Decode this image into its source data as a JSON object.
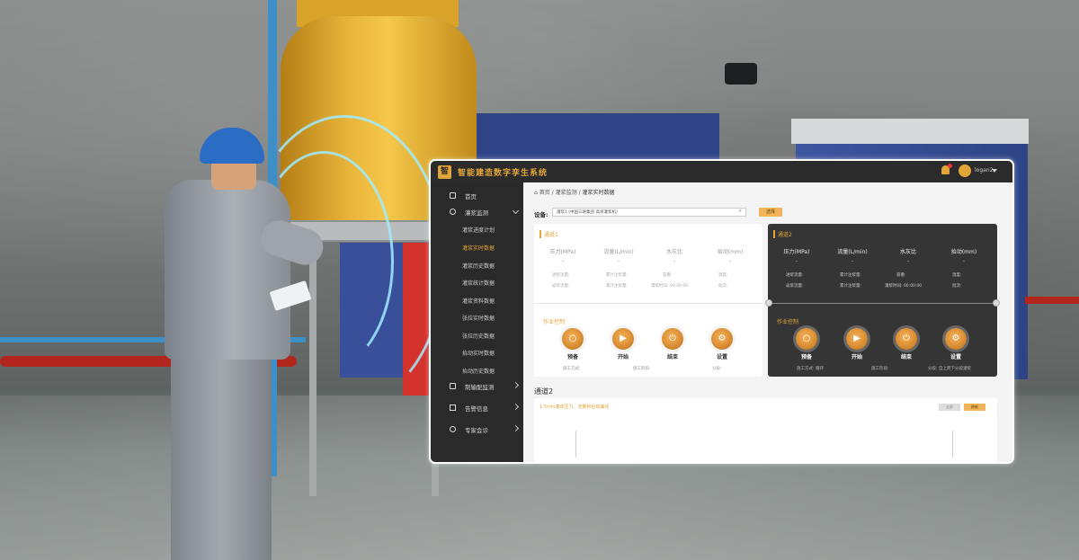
{
  "app": {
    "logo_text": "智",
    "title": "智能建造数字孪生系统",
    "username": "logan2"
  },
  "sidebar": {
    "items": [
      {
        "label": "首页"
      },
      {
        "label": "灌浆监测"
      },
      {
        "label": "制输配监测"
      },
      {
        "label": "告警信息"
      },
      {
        "label": "专家会诊"
      }
    ],
    "sub_items": [
      {
        "label": "灌浆进度计划"
      },
      {
        "label": "灌浆实时数据"
      },
      {
        "label": "灌浆历史数据"
      },
      {
        "label": "灌浆统计数据"
      },
      {
        "label": "灌浆资料数据"
      },
      {
        "label": "张拉实时数据"
      },
      {
        "label": "张拉历史数据"
      },
      {
        "label": "抬动实时数据"
      },
      {
        "label": "抬动历史数据"
      }
    ],
    "active_sub_index": 1
  },
  "breadcrumb": {
    "home": "首页",
    "sep": "/",
    "level1": "灌浆监测",
    "level2": "灌浆实时数据"
  },
  "device": {
    "label": "设备:",
    "value": "灌浆1 (中国三峡集团 高坝灌浆机)",
    "select_label": "选择"
  },
  "channel1": {
    "tag": "通道1",
    "metrics": [
      {
        "name": "压力(MPa)",
        "value": "-"
      },
      {
        "name": "流量(L/min)",
        "value": "-"
      },
      {
        "name": "水灰比",
        "value": "-"
      },
      {
        "name": "抬动(mm)",
        "value": "-"
      }
    ],
    "info_rows": [
      [
        "进浆流量:",
        "累计注浆量:",
        "容重:",
        "温度:"
      ],
      [
        "返浆流量:",
        "累计注浆量:",
        "灌浆时间: 00:00:00",
        "批次:"
      ]
    ],
    "op_title": "作业控制",
    "buttons": [
      {
        "label": "预备",
        "symbol": "○"
      },
      {
        "label": "开始",
        "symbol": "▶"
      },
      {
        "label": "结束",
        "symbol": "⏻"
      },
      {
        "label": "设置",
        "symbol": "⚙"
      }
    ],
    "footer": [
      "施工方式:",
      "施工阶段:",
      "分段:"
    ]
  },
  "channel2_card": {
    "tag": "通道2",
    "metrics": [
      {
        "name": "压力(MPa)",
        "value": "-"
      },
      {
        "name": "流量(L/min)",
        "value": "-"
      },
      {
        "name": "水灰比",
        "value": "-"
      },
      {
        "name": "抬动(mm)",
        "value": "-"
      }
    ],
    "info_rows": [
      [
        "进浆流量:",
        "累计注浆量:",
        "容重:",
        "温度:"
      ],
      [
        "返浆流量:",
        "累计注浆量:",
        "灌浆时间: 00:00:00",
        "批次:"
      ]
    ],
    "op_title": "作业控制",
    "buttons": [
      {
        "label": "预备",
        "symbol": "○"
      },
      {
        "label": "开始",
        "symbol": "▶"
      },
      {
        "label": "结束",
        "symbol": "⏻"
      },
      {
        "label": "设置",
        "symbol": "⚙"
      }
    ],
    "footer": [
      "施工方式: 循环",
      "施工阶段:",
      "分段: 自上而下分段灌浆"
    ]
  },
  "channel2_section": {
    "title": "通道2",
    "chart_title": "1.5min灌浆压力、流量和抬动曲线",
    "btn1": "全屏",
    "btn2": "刷新"
  },
  "colors": {
    "accent": "#e2a53a",
    "sidebar_bg": "#2a2a2a",
    "dark_card": "#353535"
  }
}
